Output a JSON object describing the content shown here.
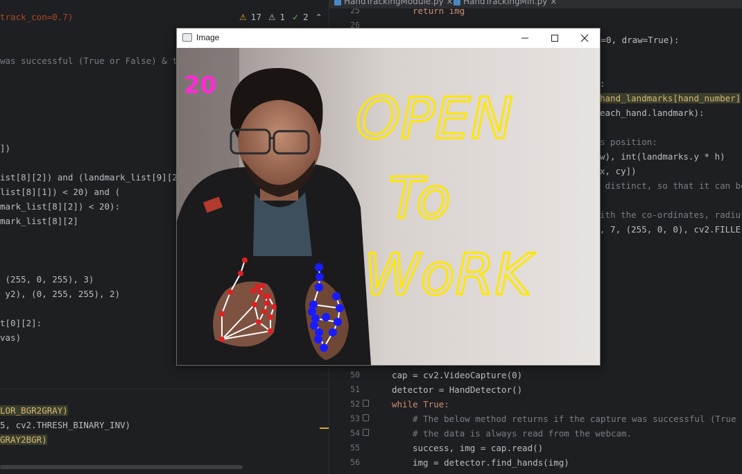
{
  "editor": {
    "tabs": [
      {
        "label": "HandTrackingModule.py"
      },
      {
        "label": "HandTrackingMin.py"
      }
    ],
    "inspections": {
      "warnings": "17",
      "weak_warnings": "1",
      "ok": "2"
    },
    "left_lines": [
      "track_con=0.7)",
      "was successful (True or False) & t",
      "])",
      "ist[8][2]) and (landmark_list[9][2",
      "list[8][1]) < 20) and (",
      "mark_list[8][2]) < 20):",
      "mark_list[8][2]",
      " (255, 0, 255), 3)",
      " y2), (0, 255, 255), 2)",
      "t[0][2]:",
      "vas)",
      "LOR_BGR2GRAY)",
      "5, cv2.THRESH_BINARY_INV)",
      "GRAY2BGR)"
    ],
    "right_lines": [
      "return img",
      "r=0, draw=True):",
      ":",
      "hand_landmarks[hand_number]",
      "each_hand.landmark):",
      "s position:",
      "w), int(landmarks.y * h)",
      "x, cy])",
      " distinct, so that it can be",
      "ith the co-ordinates, radiu",
      ", 7, (255, 0, 0), cv2.FILLE",
      "cap = cv2.VideoCapture(0)",
      "detector = HandDetector()",
      "while True:",
      "# The below method returns if the capture was successful (True",
      "# the data is always read from the webcam.",
      "success, img = cap.read()",
      "img = detector.find_hands(img)"
    ],
    "line_numbers": [
      "25",
      "26",
      "50",
      "51",
      "52",
      "53",
      "54",
      "55",
      "56"
    ]
  },
  "image_window": {
    "title": "Image",
    "fps": "20",
    "whiteboard_lines": [
      "OPEN",
      "To",
      "WoRK"
    ],
    "colors": {
      "fps": "#ff2bd6",
      "drawing": "#ffe600",
      "left_hand": "#e02020",
      "right_hand": "#1a1aff"
    }
  }
}
